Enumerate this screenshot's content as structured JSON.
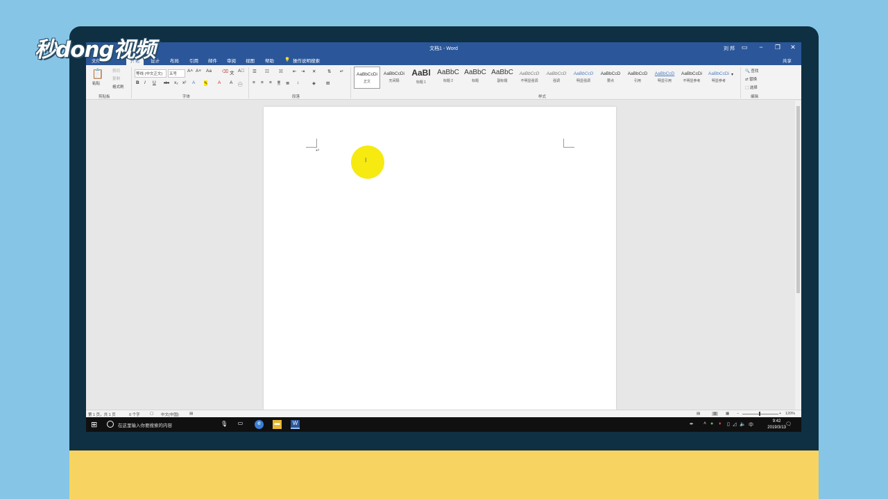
{
  "watermark": {
    "logo_text": "秒dong视频"
  },
  "window": {
    "title": "文档1 - Word",
    "user": "刘 邦",
    "controls": [
      "ribbon-display-icon",
      "minimize-icon",
      "restore-icon",
      "close-icon"
    ]
  },
  "tabs": {
    "file": "文件",
    "items": [
      "开始",
      "插入",
      "设计",
      "布局",
      "引用",
      "邮件",
      "审阅",
      "视图",
      "帮助"
    ],
    "tell_me": "操作说明搜索",
    "share": "共享"
  },
  "ribbon": {
    "clipboard": {
      "paste": "粘贴",
      "cut": "剪切",
      "copy": "复制",
      "format_painter": "格式刷",
      "label": "剪贴板"
    },
    "font": {
      "font_name": "等线 (中文正文)",
      "font_size": "五号",
      "label": "字体",
      "buttons": [
        "B",
        "I",
        "U",
        "abc",
        "x₂",
        "x²"
      ]
    },
    "paragraph": {
      "label": "段落"
    },
    "styles": {
      "label": "样式",
      "items": [
        {
          "preview": "AaBbCcDi",
          "name": "正文",
          "selected": true
        },
        {
          "preview": "AaBbCcDi",
          "name": "无间隔",
          "selected": false
        },
        {
          "preview": "AaBl",
          "name": "标题 1",
          "selected": false
        },
        {
          "preview": "AaBbC",
          "name": "标题 2",
          "selected": false
        },
        {
          "preview": "AaBbC",
          "name": "标题",
          "selected": false
        },
        {
          "preview": "AaBbC",
          "name": "副标题",
          "selected": false
        },
        {
          "preview": "AaBbCcD",
          "name": "不明显强调",
          "selected": false
        },
        {
          "preview": "AaBbCcD",
          "name": "强调",
          "selected": false
        },
        {
          "preview": "AaBbCcD",
          "name": "明显强调",
          "selected": false
        },
        {
          "preview": "AaBbCcD",
          "name": "要点",
          "selected": false
        },
        {
          "preview": "AaBbCcD",
          "name": "引用",
          "selected": false
        },
        {
          "preview": "AaBbCcD",
          "name": "明显引用",
          "selected": false
        },
        {
          "preview": "AaBbCcDi",
          "name": "不明显参考",
          "selected": false
        },
        {
          "preview": "AaBbCcDi",
          "name": "明显参考",
          "selected": false
        }
      ]
    },
    "editing": {
      "find": "查找",
      "replace": "替换",
      "select": "选择",
      "label": "编辑"
    }
  },
  "status": {
    "page": "第 1 页，共 1 页",
    "words": "0 个字",
    "language": "中文(中国)",
    "zoom": "120%"
  },
  "taskbar": {
    "search_placeholder": "在这里输入你要搜索的内容",
    "ime": "中",
    "time": "9:42",
    "date": "2019/3/13"
  },
  "colors": {
    "word_blue": "#2b579a",
    "bezel": "#0f3043",
    "background": "#86c5e6",
    "accent_yellow": "#f7d461",
    "highlight": "#f6ea10"
  }
}
